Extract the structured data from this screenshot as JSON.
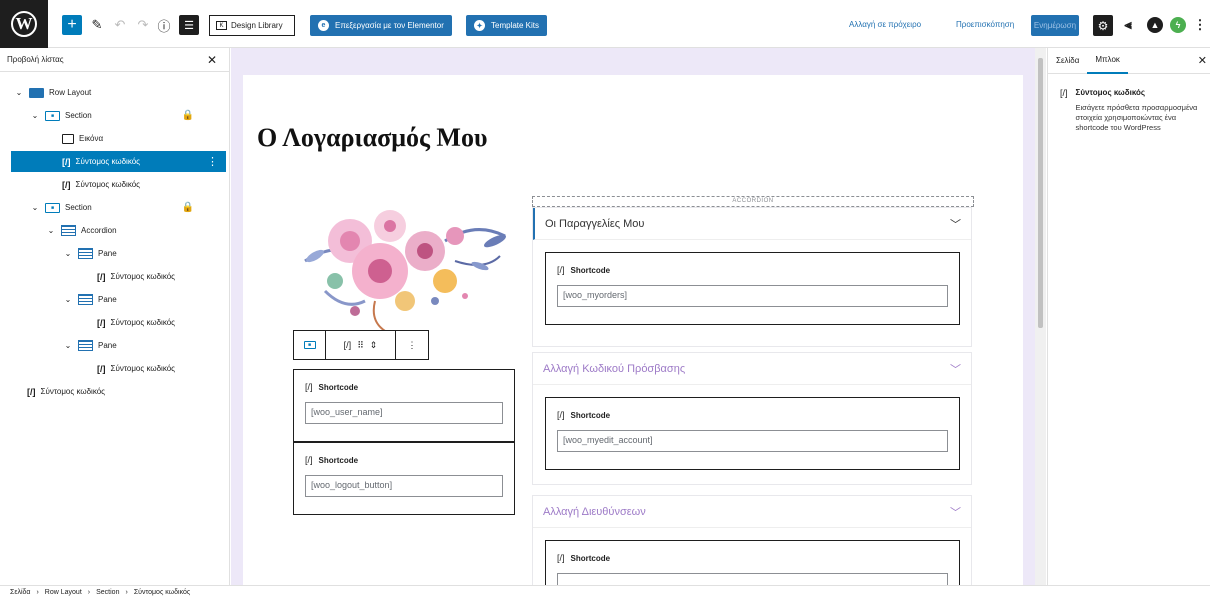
{
  "topbar": {
    "design_library": "Design Library",
    "edit_elementor": "Επεξεργασία με τον Elementor",
    "template_kits": "Template Kits",
    "save_draft": "Αλλαγή σε πρόχειρο",
    "preview": "Προεπισκόπηση",
    "publish": "Ενημέρωση"
  },
  "left_panel": {
    "title": "Προβολή λίστας",
    "items": [
      {
        "label": "Row Layout"
      },
      {
        "label": "Section"
      },
      {
        "label": "Εικόνα"
      },
      {
        "label": "Σύντομος κωδικός"
      },
      {
        "label": "Σύντομος κωδικός"
      },
      {
        "label": "Section"
      },
      {
        "label": "Accordion"
      },
      {
        "label": "Pane"
      },
      {
        "label": "Σύντομος κωδικός"
      },
      {
        "label": "Pane"
      },
      {
        "label": "Σύντομος κωδικός"
      },
      {
        "label": "Pane"
      },
      {
        "label": "Σύντομος κωδικός"
      },
      {
        "label": "Σύντομος κωδικός"
      }
    ]
  },
  "canvas": {
    "page_title": "Ο Λογαριασμός Μου",
    "left_shortcodes": [
      {
        "label": "Shortcode",
        "value": "[woo_user_name]"
      },
      {
        "label": "Shortcode",
        "value": "[woo_logout_button]"
      }
    ],
    "accordion_tag": "ACCORDION",
    "panes": [
      {
        "title": "Οι Παραγγελίες Μου",
        "label": "Shortcode",
        "value": "[woo_myorders]"
      },
      {
        "title": "Αλλαγή Κωδικού Πρόσβασης",
        "label": "Shortcode",
        "value": "[woo_myedit_account]"
      },
      {
        "title": "Αλλαγή Διευθύνσεων",
        "label": "Shortcode",
        "value": ""
      }
    ]
  },
  "right_panel": {
    "tabs": [
      "Σελίδα",
      "Μπλοκ"
    ],
    "block_title": "Σύντομος κωδικός",
    "block_desc": "Εισάγετε πρόσθετα προσαρμοσμένα στοιχεία χρησιμοποιώντας ένα shortcode του WordPress"
  },
  "breadcrumb": [
    "Σελίδα",
    "Row Layout",
    "Section",
    "Σύντομος κωδικός"
  ],
  "colors": {
    "accent": "#007cba",
    "canvas_bg": "#ede8f8",
    "pane_title": "#9d7ac7"
  }
}
